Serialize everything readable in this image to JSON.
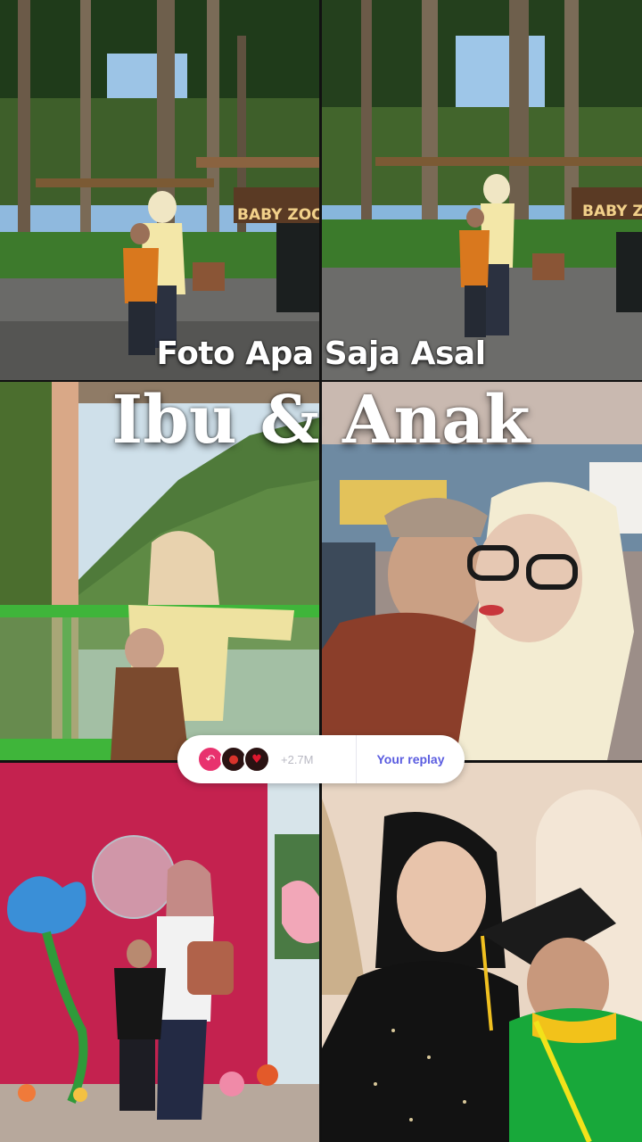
{
  "overlay": {
    "subtitle": "Foto Apa Saja Asal",
    "title": "Ibu & Anak"
  },
  "photos": {
    "p1_sign": "BABY ZOO",
    "p2_sign": "BABY Z"
  },
  "reply_bar": {
    "reactions": [
      {
        "icon": "reply-arrow-icon",
        "glyph": "↶",
        "color": "#e8326e"
      },
      {
        "icon": "tomato-icon",
        "glyph": "●",
        "color": "#d9332b"
      },
      {
        "icon": "lips-icon",
        "glyph": "♥",
        "color": "#e0182f"
      }
    ],
    "count": "+2.7M",
    "reply_label": "Your replay"
  }
}
